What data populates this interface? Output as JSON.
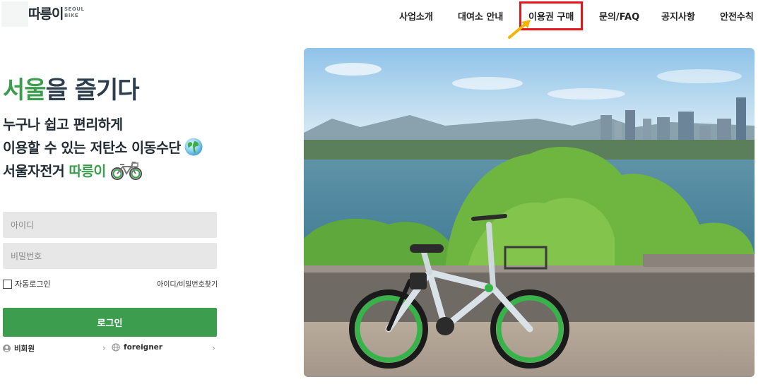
{
  "brand": {
    "logo_text": "따릉이",
    "logo_sub_line1": "SEOUL",
    "logo_sub_line2": "BIKE"
  },
  "nav": {
    "items": [
      {
        "label": "사업소개"
      },
      {
        "label": "대여소 안내"
      },
      {
        "label": "이용권 구매"
      },
      {
        "label": "문의/FAQ"
      },
      {
        "label": "공지사항"
      },
      {
        "label": "안전수칙"
      }
    ],
    "highlight_color": "#e8141b",
    "arrow_color": "#f5b400"
  },
  "hero": {
    "title_green": "서울",
    "title_rest": "을 즐기다",
    "line1": "누구나 쉽고 편리하게",
    "line2": "이용할 수 있는 저탄소 이동수단",
    "line3_prefix": "서울자전거 ",
    "line3_green": "따릉이",
    "accent_color": "#3d9d4f"
  },
  "login": {
    "id_placeholder": "아이디",
    "pw_placeholder": "비밀번호",
    "auto_login_label": "자동로그인",
    "find_link": "아이디/비밀번호찾기",
    "login_button": "로그인",
    "guest_label": "비회원",
    "foreigner_label": "foreigner"
  },
  "icons": {
    "globe": "globe-icon",
    "bike": "bicycle-icon",
    "guest": "user-icon",
    "foreigner": "globe-small-icon",
    "chevron": "chevron-right-icon"
  }
}
